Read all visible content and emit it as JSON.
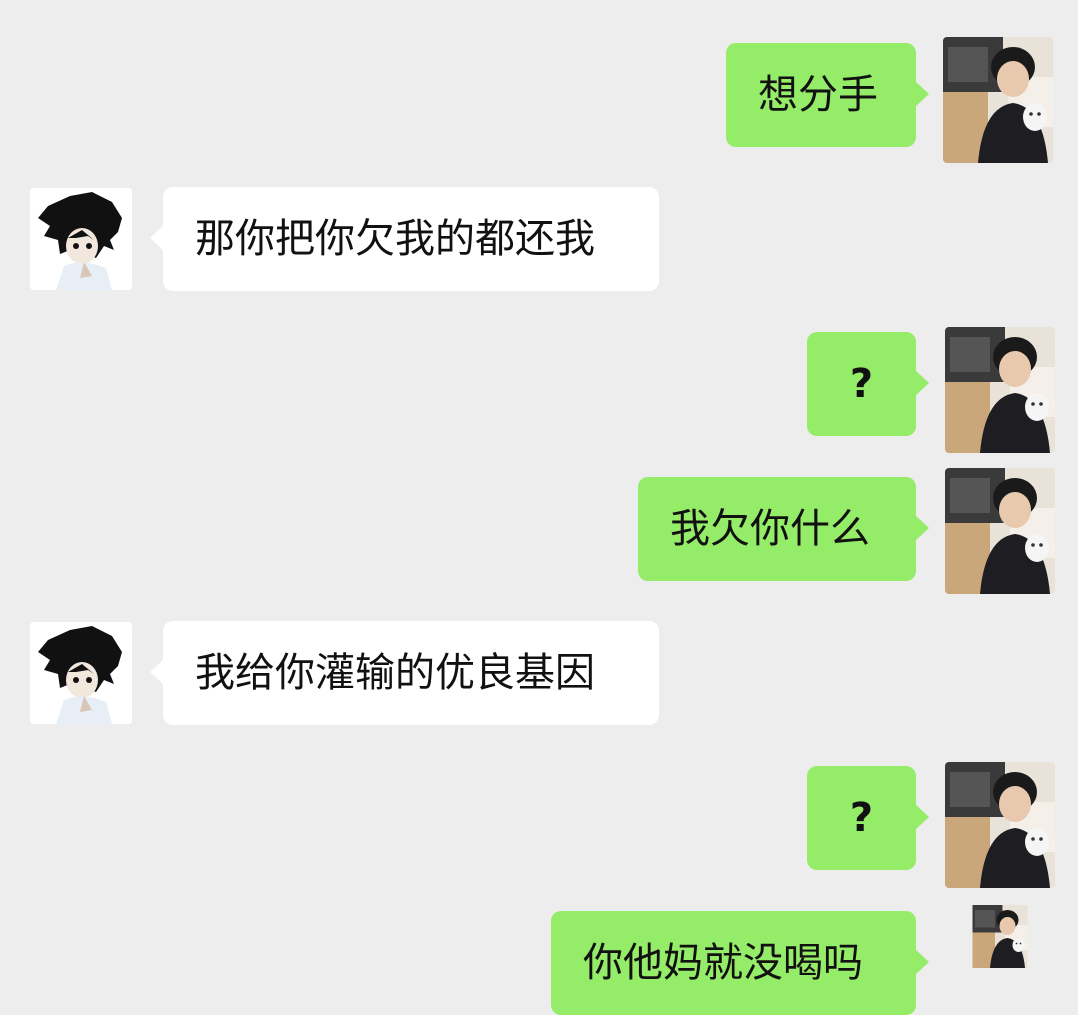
{
  "messages": [
    {
      "side": "right",
      "text": "想分手"
    },
    {
      "side": "left",
      "text": "那你把你欠我的都还我"
    },
    {
      "side": "right",
      "text": "?"
    },
    {
      "side": "right",
      "text": "我欠你什么"
    },
    {
      "side": "left",
      "text": "我给你灌输的优良基因"
    },
    {
      "side": "right",
      "text": "?"
    },
    {
      "side": "right",
      "text": "你他妈就没喝吗"
    }
  ],
  "colors": {
    "background": "#ededed",
    "self_bubble": "#95ec69",
    "other_bubble": "#ffffff",
    "text": "#111111"
  },
  "icons": {
    "self_avatar": "photo-avatar",
    "other_avatar": "anime-avatar"
  }
}
